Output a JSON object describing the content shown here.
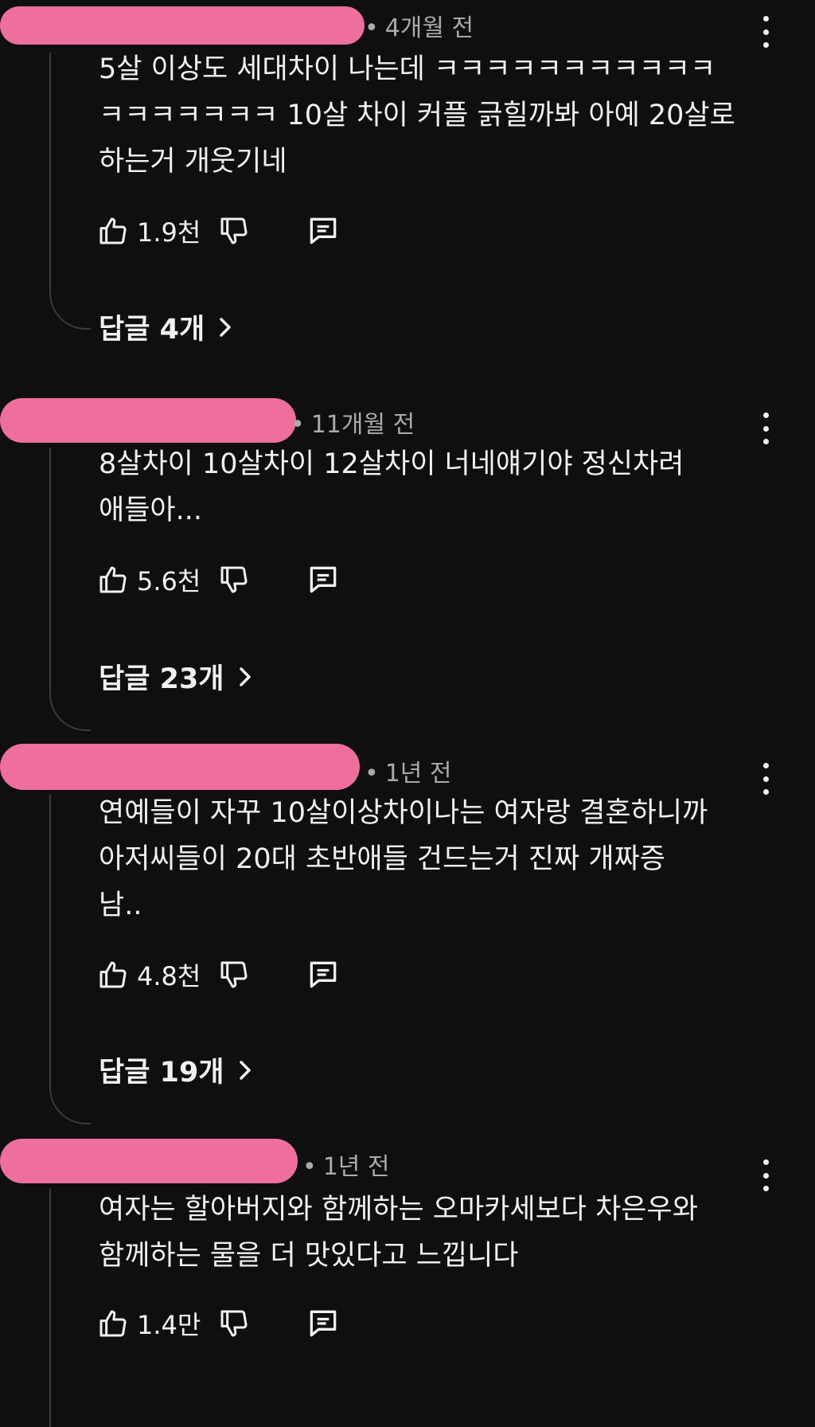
{
  "comments": [
    {
      "time": "4개월 전",
      "text": "5살 이상도 세대차이 나는데 ㅋㅋㅋㅋㅋㅋㅋㅋㅋㅋㅋ\nㅋㅋㅋㅋㅋㅋㅋ 10살 차이 커플 긁힐까봐 아예 20살로\n하는거 개웃기네",
      "likes": "1.9천",
      "replies": "답글 4개"
    },
    {
      "time": "11개월 전",
      "text": "8살차이 10살차이 12살차이 너네얘기야 정신차려\n애들아...",
      "likes": "5.6천",
      "replies": "답글 23개"
    },
    {
      "time": "1년 전",
      "text": "연예들이 자꾸 10살이상차이나는 여자랑 결혼하니까\n아저씨들이 20대 초반애들 건드는거 진짜 개짜증\n남..",
      "likes": "4.8천",
      "replies": "답글 19개"
    },
    {
      "time": "1년 전",
      "text": "여자는 할아버지와 함께하는 오마카세보다 차은우와\n함께하는 물을 더 맛있다고 느낍니다",
      "likes": "1.4만",
      "replies": ""
    }
  ],
  "icons": {
    "like": "thumbs-up-icon",
    "dislike": "thumbs-down-icon",
    "reply": "comment-reply-icon",
    "more": "more-vertical-icon",
    "chevron": "chevron-right-icon"
  },
  "colors": {
    "background": "#0f0f0f",
    "text": "#f1f1f1",
    "meta": "#aaaaaa",
    "redaction": "#ee6f9e"
  }
}
